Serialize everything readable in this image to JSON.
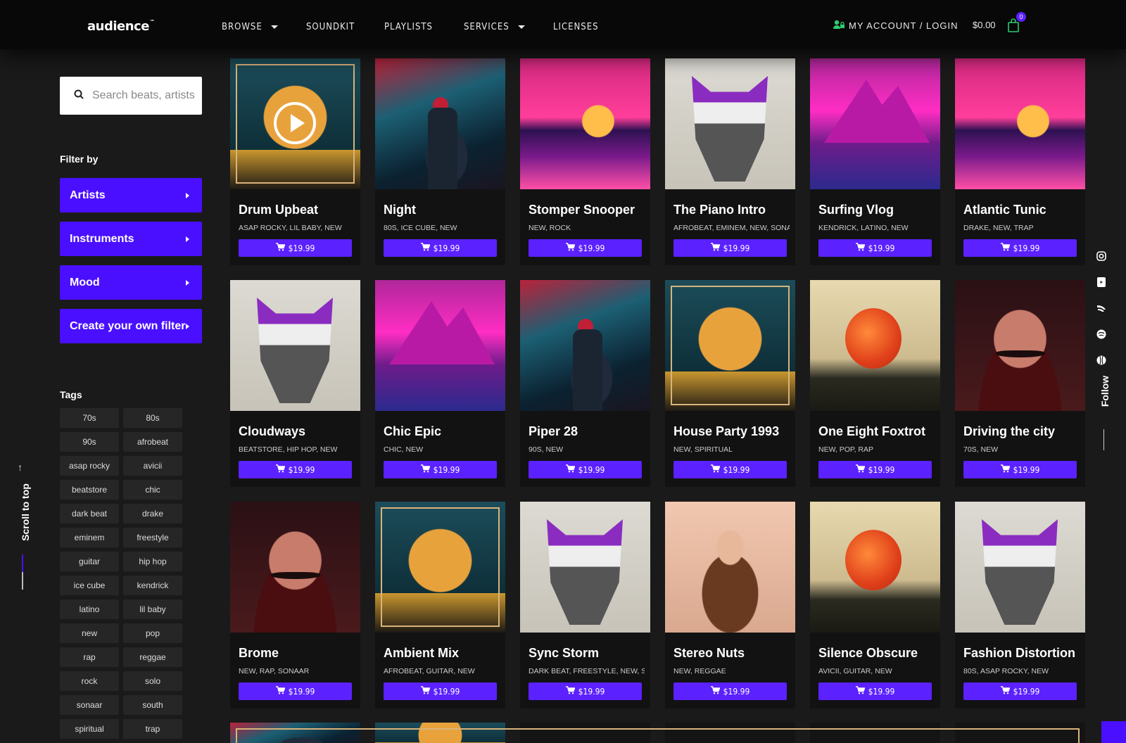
{
  "header": {
    "logo": "audience",
    "logo_tm": "™",
    "nav": [
      {
        "label": "BROWSE",
        "dropdown": true
      },
      {
        "label": "SOUNDKIT",
        "dropdown": false
      },
      {
        "label": "PLAYLISTS",
        "dropdown": false
      },
      {
        "label": "SERVICES",
        "dropdown": true
      },
      {
        "label": "LICENSES",
        "dropdown": false
      }
    ],
    "account_label": "MY ACCOUNT / LOGIN",
    "cart_total": "$0.00",
    "cart_count": "0"
  },
  "sidebar": {
    "search_placeholder": "Search beats, artists",
    "filter_label": "Filter by",
    "filters": [
      "Artists",
      "Instruments",
      "Mood",
      "Create your own filter"
    ],
    "tags_label": "Tags",
    "tags": [
      "70s",
      "80s",
      "90s",
      "afrobeat",
      "asap rocky",
      "avicii",
      "beatstore",
      "chic",
      "dark beat",
      "drake",
      "eminem",
      "freestyle",
      "guitar",
      "hip hop",
      "ice cube",
      "kendrick",
      "latino",
      "lil baby",
      "new",
      "pop",
      "rap",
      "reggae",
      "rock",
      "solo",
      "sonaar",
      "south",
      "spiritual",
      "trap"
    ],
    "scroll_to_top": "Scroll to top"
  },
  "social": {
    "follow_label": "Follow",
    "icons": [
      "instagram-icon",
      "youtube-icon",
      "tiktok-icon",
      "pinterest-icon",
      "dribbble-icon"
    ]
  },
  "products": [
    {
      "title": "Drum Upbeat",
      "tags": "ASAP ROCKY, LIL BABY, NEW",
      "price": "$19.99",
      "art": "planet",
      "playing": true
    },
    {
      "title": "Night",
      "tags": "80S, ICE CUBE, NEW",
      "price": "$19.99",
      "art": "city"
    },
    {
      "title": "Stomper Snooper",
      "tags": "NEW, ROCK",
      "price": "$19.99",
      "art": "sunset"
    },
    {
      "title": "The Piano Intro",
      "tags": "AFROBEAT, EMINEM, NEW, SONAAR",
      "price": "$19.99",
      "art": "skull"
    },
    {
      "title": "Surfing Vlog",
      "tags": "KENDRICK, LATINO, NEW",
      "price": "$19.99",
      "art": "mountains"
    },
    {
      "title": "Atlantic Tunic",
      "tags": "DRAKE, NEW, TRAP",
      "price": "$19.99",
      "art": "sunset"
    },
    {
      "title": "Cloudways",
      "tags": "BEATSTORE, HIP HOP, NEW",
      "price": "$19.99",
      "art": "skull"
    },
    {
      "title": "Chic Epic",
      "tags": "CHIC, NEW",
      "price": "$19.99",
      "art": "mountains"
    },
    {
      "title": "Piper 28",
      "tags": "90S, NEW",
      "price": "$19.99",
      "art": "city"
    },
    {
      "title": "House Party 1993",
      "tags": "NEW, SPIRITUAL",
      "price": "$19.99",
      "art": "planet"
    },
    {
      "title": "One Eight Foxtrot",
      "tags": "NEW, POP, RAP",
      "price": "$19.99",
      "art": "balloon"
    },
    {
      "title": "Driving the city",
      "tags": "70S, NEW",
      "price": "$19.99",
      "art": "man"
    },
    {
      "title": "Brome",
      "tags": "NEW, RAP, SONAAR",
      "price": "$19.99",
      "art": "man"
    },
    {
      "title": "Ambient Mix",
      "tags": "AFROBEAT, GUITAR, NEW",
      "price": "$19.99",
      "art": "planet"
    },
    {
      "title": "Sync Storm",
      "tags": "DARK BEAT, FREESTYLE, NEW, SOLO",
      "price": "$19.99",
      "art": "skull"
    },
    {
      "title": "Stereo Nuts",
      "tags": "NEW, REGGAE",
      "price": "$19.99",
      "art": "nuts"
    },
    {
      "title": "Silence Obscure",
      "tags": "AVICII, GUITAR, NEW",
      "price": "$19.99",
      "art": "balloon"
    },
    {
      "title": "Fashion Distortion",
      "tags": "80S, ASAP ROCKY, NEW",
      "price": "$19.99",
      "art": "skull"
    }
  ],
  "partial_row_art": [
    "city",
    "planet",
    "dark",
    "dark",
    "dark",
    "dark"
  ],
  "colors": {
    "accent": "#5b21ff",
    "filter_button": "#4a0fff",
    "account_icon": "#2ecc71",
    "background": "#1a1a1a"
  }
}
